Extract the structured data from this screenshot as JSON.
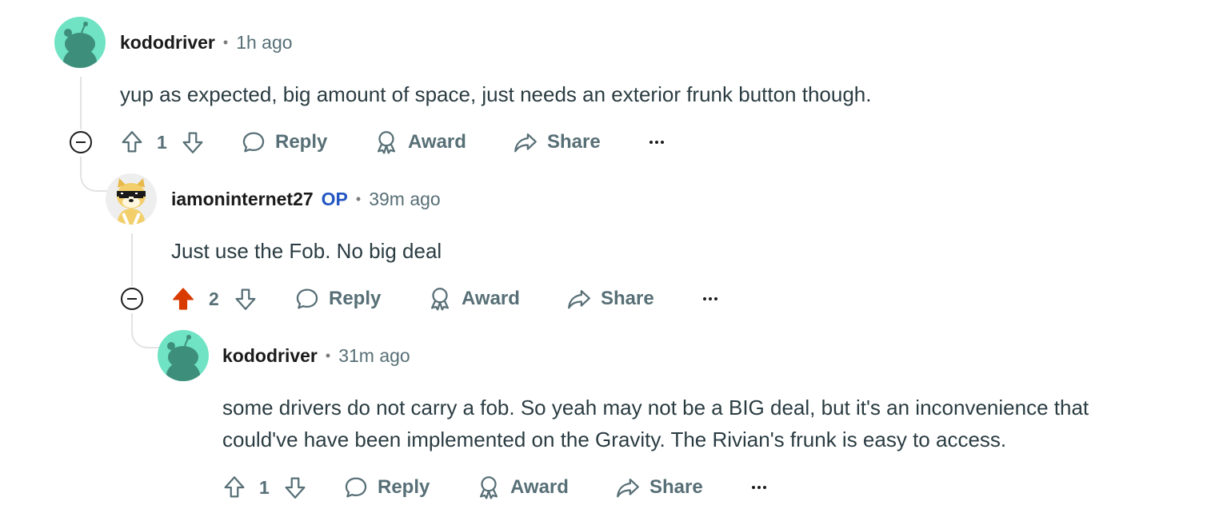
{
  "comments": [
    {
      "username": "kododriver",
      "time": "1h ago",
      "body": [
        "yup as expected, big amount of space, just needs an exterior frunk button though."
      ],
      "votes": "1",
      "upvoted": false,
      "avatar": "snoo-avatar-teal"
    },
    {
      "username": "iamoninternet27",
      "op_badge": "OP",
      "time": "39m ago",
      "body": [
        "Just use the Fob. No big deal"
      ],
      "votes": "2",
      "upvoted": true,
      "avatar": "doge-avatar-sunglasses"
    },
    {
      "username": "kododriver",
      "time": "31m ago",
      "body": [
        "some drivers do not carry a fob. So yeah may not be a BIG deal, but it's an inconvenience that",
        "could've have been implemented on the Gravity. The Rivian's frunk is easy to access."
      ],
      "votes": "1",
      "upvoted": false,
      "avatar": "snoo-avatar-teal"
    }
  ],
  "actions": {
    "reply": "Reply",
    "award": "Award",
    "share": "Share"
  },
  "separator": "•",
  "colors": {
    "upvote_active": "#d93a00",
    "op_badge": "#2456c2",
    "avatar_teal": "#6fe3c3",
    "icon_gray": "#576f76"
  }
}
